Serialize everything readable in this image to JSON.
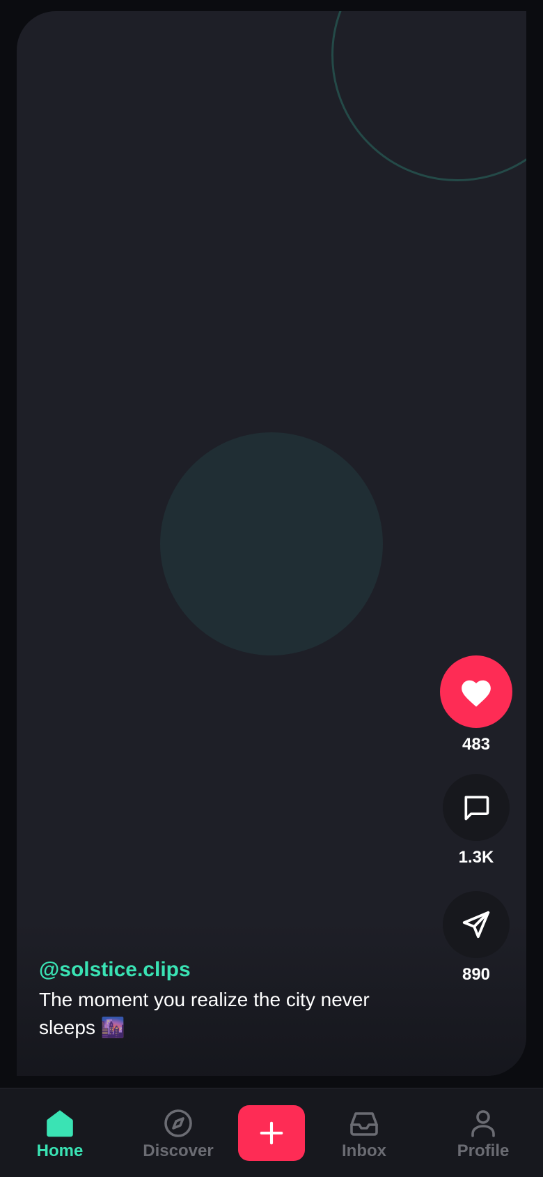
{
  "post": {
    "handle": "@solstice.clips",
    "description": "The moment you realize the city never sleeps 🌆"
  },
  "actions": {
    "likes": "483",
    "comments": "1.3K",
    "shares": "890"
  },
  "tabs": [
    {
      "label": "Home",
      "icon": "home-icon",
      "active": true
    },
    {
      "label": "Discover",
      "icon": "compass-icon",
      "active": false
    },
    {
      "label": "",
      "icon": "plus-icon",
      "active": false
    },
    {
      "label": "Inbox",
      "icon": "inbox-icon",
      "active": false
    },
    {
      "label": "Profile",
      "icon": "user-icon",
      "active": false
    }
  ],
  "colors": {
    "accent": "#3ae3b4",
    "like": "#fe2c55",
    "background": "#1e1f27"
  }
}
